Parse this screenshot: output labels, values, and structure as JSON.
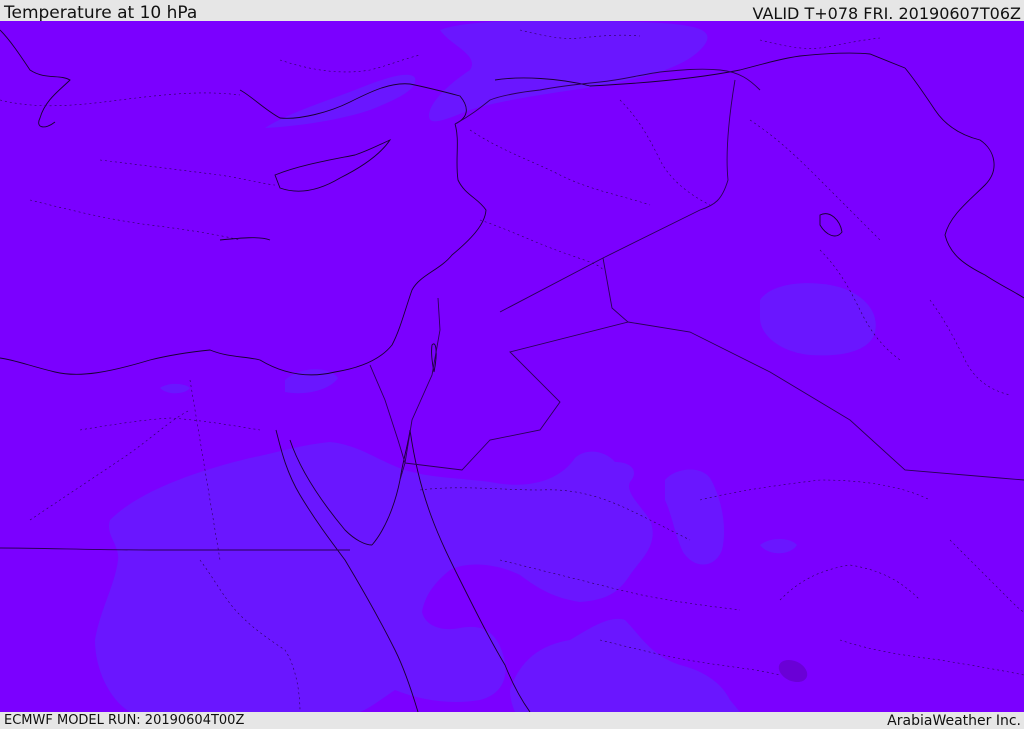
{
  "header": {
    "title": "Temperature at 10 hPa",
    "valid": "VALID T+078 FRI. 20190607T06Z"
  },
  "footer": {
    "model_run": "ECMWF MODEL RUN: 20190604T00Z",
    "credit": "ArabiaWeather Inc."
  },
  "map": {
    "field": "Temperature",
    "level": "10 hPa",
    "colors": {
      "background_fill": "#7b00ff",
      "warmer_patch_fill": "#6a16ff",
      "darker_spot_fill": "#6a00d6",
      "coastline": "#1a0033",
      "border": "#2a0055"
    },
    "layers": [
      "temperature-field",
      "coastlines",
      "country-borders",
      "sub-national-borders"
    ]
  }
}
